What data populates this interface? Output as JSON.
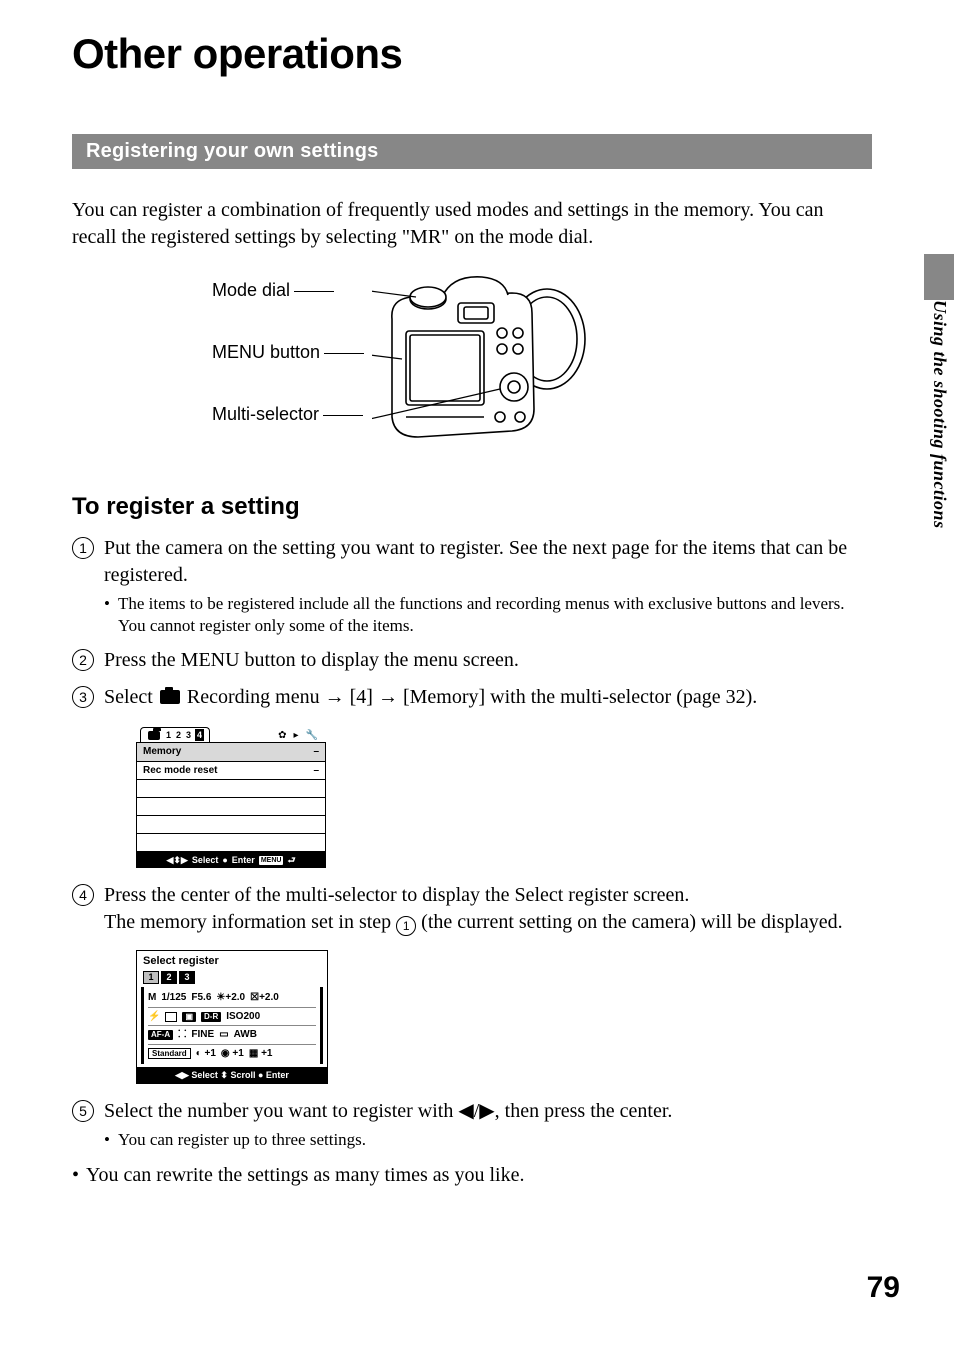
{
  "title": "Other operations",
  "section_bar": "Registering your own settings",
  "intro": "You can register a combination of frequently used modes and settings in the memory. You can recall the registered settings by selecting \"MR\" on the mode dial.",
  "camera_labels": {
    "mode_dial": "Mode dial",
    "menu_button": "MENU button",
    "multi_selector": "Multi-selector"
  },
  "subhead": "To register a setting",
  "steps": {
    "s1": "Put the camera on the setting you want to register. See the next page for the items that can be registered.",
    "s1_sub": "The items to be registered include all the functions and recording menus with exclusive buttons and levers. You cannot register only some of the items.",
    "s2": "Press the MENU button to display the menu screen.",
    "s3_pre": "Select ",
    "s3_post": " Recording menu → [4] → [Memory] with the multi-selector (page 32).",
    "s4a": "Press the center of the multi-selector to display the Select register screen.",
    "s4b_pre": "The memory information set in step ",
    "s4b_mid": "1",
    "s4b_post": " (the current setting on the camera) will be displayed.",
    "s5": "Select the number you want to register with ◀/▶, then press the center.",
    "s5_sub": "You can register up to three settings."
  },
  "outer_bullet": "You can rewrite the settings as many times as you like.",
  "menu_shot": {
    "tabs_nums": [
      "1",
      "2",
      "3",
      "4"
    ],
    "rows": [
      {
        "label": "Memory",
        "value": "–"
      },
      {
        "label": "Rec mode reset",
        "value": "–"
      },
      {
        "label": "",
        "value": ""
      },
      {
        "label": "",
        "value": ""
      },
      {
        "label": "",
        "value": ""
      },
      {
        "label": "",
        "value": ""
      }
    ],
    "footer_select": "Select",
    "footer_enter": "Enter",
    "footer_menu": "MENU"
  },
  "reg_shot": {
    "title": "Select register",
    "tabs": [
      "1",
      "2",
      "3"
    ],
    "line1": {
      "mode": "M",
      "shutter": "1/125",
      "f": "F5.6",
      "ev1": "+2.0",
      "ev2": "+2.0"
    },
    "line2": {
      "dr": "D-R",
      "iso": "ISO200"
    },
    "line3": {
      "af": "AF-A",
      "q": "FINE",
      "wb": "AWB"
    },
    "line4": {
      "std": "Standard",
      "c": "+1",
      "s": "+1",
      "sh": "+1"
    },
    "footer": "◀▶ Select  ⬍ Scroll  ● Enter"
  },
  "side_label": "Using the shooting functions",
  "page_number": "79"
}
